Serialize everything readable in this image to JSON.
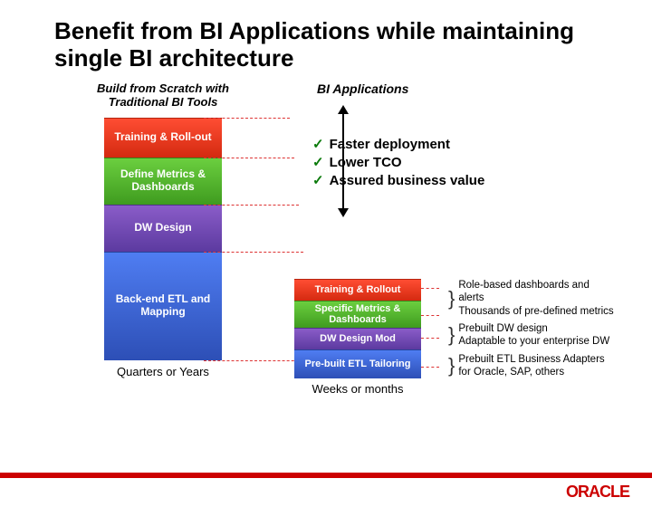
{
  "title": "Benefit from BI Applications while maintaining single BI architecture",
  "left": {
    "header": "Build from Scratch with Traditional BI Tools",
    "blocks": [
      "Training & Roll-out",
      "Define Metrics & Dashboards",
      "DW Design",
      "Back-end ETL and Mapping"
    ],
    "timeline": "Quarters or Years"
  },
  "right": {
    "header": "BI Applications",
    "benefits": [
      "Faster deployment",
      "Lower TCO",
      "Assured business value"
    ],
    "blocks": [
      "Training & Rollout",
      "Specific Metrics & Dashboards",
      "DW Design Mod",
      "Pre-built ETL Tailoring"
    ],
    "descriptions": [
      "Role-based dashboards and alerts",
      "Thousands of pre-defined metrics",
      "Prebuilt DW design",
      "Adaptable to your enterprise DW",
      "Prebuilt ETL Business Adapters for Oracle, SAP, others"
    ],
    "timeline": "Weeks or months"
  },
  "brand": "ORACLE"
}
